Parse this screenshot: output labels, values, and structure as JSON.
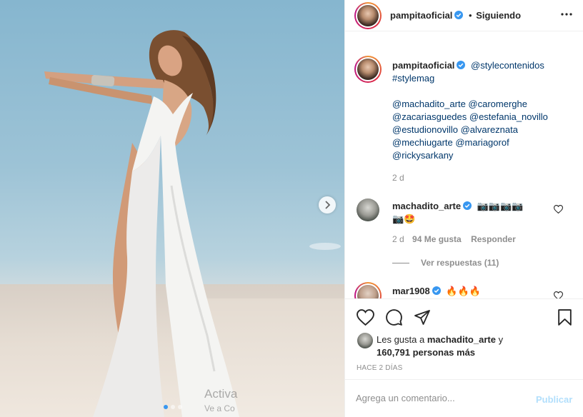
{
  "post": {
    "author": "pampitaoficial",
    "follow_separator": "•",
    "follow_status": "Siguiendo",
    "carousel": {
      "current": 1,
      "total": 3
    }
  },
  "caption": {
    "author": "pampitaoficial",
    "line1_mention": "@stylecontenidos",
    "line2_tag": "#stylemag",
    "mentions": [
      "@machadito_arte @caromerghe",
      "@zacariasguedes @estefania_novillo",
      "@estudionovillo @alvareznata",
      "@mechiugarte @mariagorof",
      "@rickysarkany"
    ],
    "time": "2 d"
  },
  "comments": [
    {
      "author": "machadito_arte",
      "text_line1": "📷📷📷📷",
      "text_line2": "📷🤩",
      "time": "2 d",
      "likes": "94 Me gusta",
      "reply": "Responder",
      "view_replies": "Ver respuestas (11)"
    },
    {
      "author": "mar1908",
      "text_line1": "🔥🔥🔥"
    }
  ],
  "likes": {
    "prefix": "Les gusta a",
    "user": "machadito_arte",
    "conj": "y",
    "others": "160,791 personas más"
  },
  "timestamp": "HACE 2 DÍAS",
  "add_comment": {
    "placeholder": "Agrega un comentario...",
    "publish": "Publicar"
  },
  "overlay": {
    "line1": "Activa",
    "line2": "Ve a Co"
  },
  "colors": {
    "verified": "#3897f0",
    "link": "#00376b",
    "muted": "#8e8e8e",
    "publish_disabled": "#b2dffc"
  }
}
